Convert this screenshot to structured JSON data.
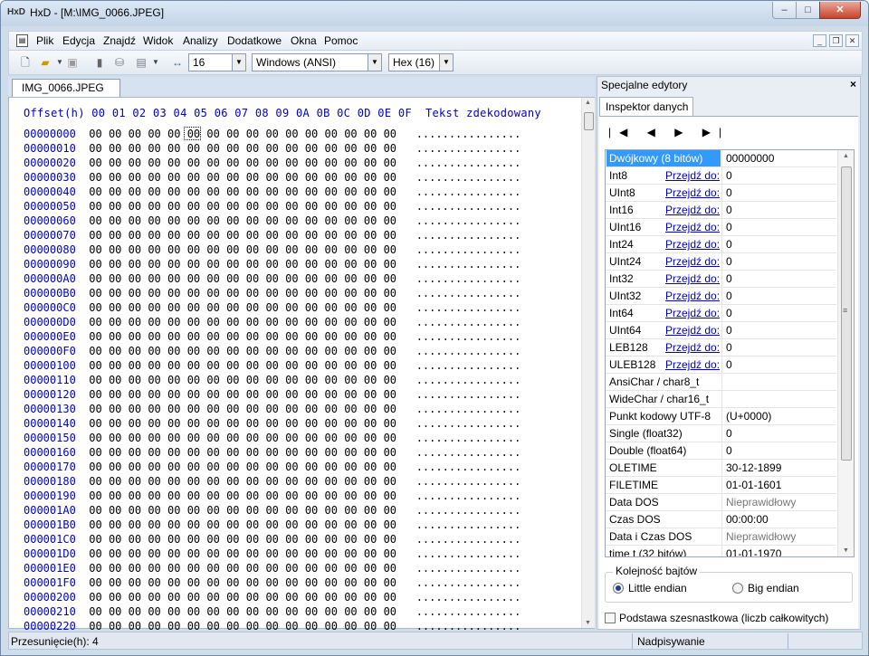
{
  "window": {
    "title": "HxD - [M:\\IMG_0066.JPEG]",
    "app_icon": "HxD",
    "controls": {
      "minimize": "–",
      "maximize": "□",
      "close": "✕"
    }
  },
  "menu": [
    "Plik",
    "Edycja",
    "Znajdź",
    "Widok",
    "Analizy",
    "Dodatkowe",
    "Okna",
    "Pomoc"
  ],
  "mdi_controls": {
    "minimize": "_",
    "restore": "❐",
    "close": "✕"
  },
  "toolbar": {
    "bytes_per_row": "16",
    "charset": "Windows (ANSI)",
    "offset_base": "Hex (16)"
  },
  "document_tab": "IMG_0066.JPEG",
  "hex_view": {
    "header_offset": "Offset(h)",
    "column_headers": [
      "00",
      "01",
      "02",
      "03",
      "04",
      "05",
      "06",
      "07",
      "08",
      "09",
      "0A",
      "0B",
      "0C",
      "0D",
      "0E",
      "0F"
    ],
    "header_text": "Tekst zdekodowany",
    "offsets": [
      "00000000",
      "00000010",
      "00000020",
      "00000030",
      "00000040",
      "00000050",
      "00000060",
      "00000070",
      "00000080",
      "00000090",
      "000000A0",
      "000000B0",
      "000000C0",
      "000000D0",
      "000000E0",
      "000000F0",
      "00000100",
      "00000110",
      "00000120",
      "00000130",
      "00000140",
      "00000150",
      "00000160",
      "00000170",
      "00000180",
      "00000190",
      "000001A0",
      "000001B0",
      "000001C0",
      "000001D0",
      "000001E0",
      "000001F0",
      "00000200",
      "00000210",
      "00000220"
    ],
    "byte_value": "00",
    "decoded_row": "................"
  },
  "right_panel": {
    "title": "Specjalne edytory",
    "close": "×",
    "tab": "Inspektor danych",
    "nav_buttons": "|◀ ◀ ▶ ▶|",
    "rows": [
      {
        "name": "Dwójkowy (8 bitów)",
        "link": "",
        "value": "00000000",
        "selected": true
      },
      {
        "name": "Int8",
        "link": "Przejdź do:",
        "value": "0"
      },
      {
        "name": "UInt8",
        "link": "Przejdź do:",
        "value": "0"
      },
      {
        "name": "Int16",
        "link": "Przejdź do:",
        "value": "0"
      },
      {
        "name": "UInt16",
        "link": "Przejdź do:",
        "value": "0"
      },
      {
        "name": "Int24",
        "link": "Przejdź do:",
        "value": "0"
      },
      {
        "name": "UInt24",
        "link": "Przejdź do:",
        "value": "0"
      },
      {
        "name": "Int32",
        "link": "Przejdź do:",
        "value": "0"
      },
      {
        "name": "UInt32",
        "link": "Przejdź do:",
        "value": "0"
      },
      {
        "name": "Int64",
        "link": "Przejdź do:",
        "value": "0"
      },
      {
        "name": "UInt64",
        "link": "Przejdź do:",
        "value": "0"
      },
      {
        "name": "LEB128",
        "link": "Przejdź do:",
        "value": "0"
      },
      {
        "name": "ULEB128",
        "link": "Przejdź do:",
        "value": "0"
      },
      {
        "name": "AnsiChar / char8_t",
        "link": "",
        "value": ""
      },
      {
        "name": "WideChar / char16_t",
        "link": "",
        "value": ""
      },
      {
        "name": "Punkt kodowy UTF-8",
        "link": "",
        "value": "   (U+0000)"
      },
      {
        "name": "Single (float32)",
        "link": "",
        "value": "0"
      },
      {
        "name": "Double (float64)",
        "link": "",
        "value": "0"
      },
      {
        "name": "OLETIME",
        "link": "",
        "value": "30-12-1899"
      },
      {
        "name": "FILETIME",
        "link": "",
        "value": "01-01-1601"
      },
      {
        "name": "Data DOS",
        "link": "",
        "value": "Nieprawidłowy",
        "gray": true
      },
      {
        "name": "Czas DOS",
        "link": "",
        "value": "00:00:00"
      },
      {
        "name": "Data i Czas DOS",
        "link": "",
        "value": "Nieprawidłowy",
        "gray": true
      },
      {
        "name": "time t (32 bitów)",
        "link": "",
        "value": "01-01-1970"
      }
    ],
    "byte_order": {
      "legend": "Kolejność bajtów",
      "little": "Little endian",
      "big": "Big endian",
      "selected": "little"
    },
    "hex_base_checkbox": "Podstawa szesnastkowa (liczb całkowitych)"
  },
  "status": {
    "offset": "Przesunięcie(h): 4",
    "mode": "Nadpisywanie"
  }
}
